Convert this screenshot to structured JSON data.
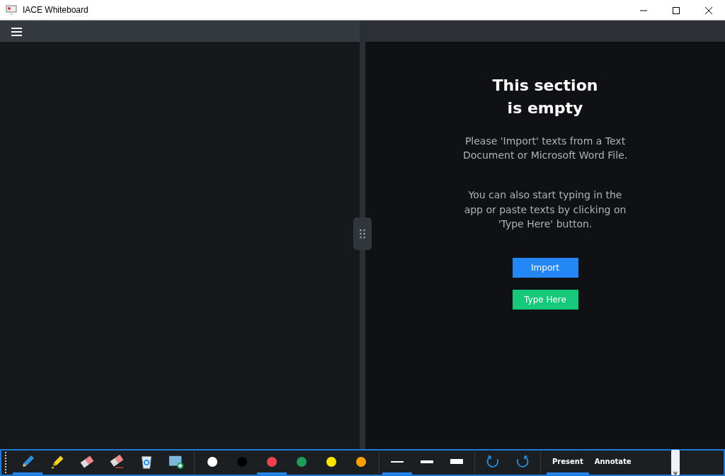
{
  "window": {
    "title": "IACE Whiteboard"
  },
  "empty_state": {
    "heading_lines": [
      "This section",
      "is empty"
    ],
    "paragraphs": [
      "Please 'Import' texts from a Text Document or Microsoft Word File.",
      "You can also start typing in the app or paste texts by clicking on 'Type Here' button."
    ],
    "buttons": [
      {
        "label": "Import",
        "kind": "primary"
      },
      {
        "label": "Type Here",
        "kind": "success"
      }
    ]
  },
  "toolbar": {
    "tools": [
      {
        "kind": "pen",
        "selected": true
      },
      {
        "kind": "highlighter",
        "selected": false
      },
      {
        "kind": "eraser",
        "selected": false
      },
      {
        "kind": "stroke-eraser",
        "selected": false
      },
      {
        "kind": "clear",
        "selected": false
      },
      {
        "kind": "background",
        "selected": false
      }
    ],
    "colors": [
      {
        "color": "#ffffff",
        "selected": false
      },
      {
        "color": "#000000",
        "selected": false
      },
      {
        "color": "#ef4050",
        "selected": true
      },
      {
        "color": "#1e9e5a",
        "selected": false
      },
      {
        "color": "#ffe600",
        "selected": false
      },
      {
        "color": "#ffa000",
        "selected": false
      }
    ],
    "thicknesses": [
      {
        "kind": "thin",
        "selected": true
      },
      {
        "kind": "medium",
        "selected": false
      },
      {
        "kind": "thick",
        "selected": false
      }
    ],
    "history": [
      {
        "kind": "undo"
      },
      {
        "kind": "redo"
      }
    ],
    "modes": [
      {
        "label": "Present",
        "selected": true
      },
      {
        "label": "Annotate",
        "selected": false
      }
    ]
  }
}
